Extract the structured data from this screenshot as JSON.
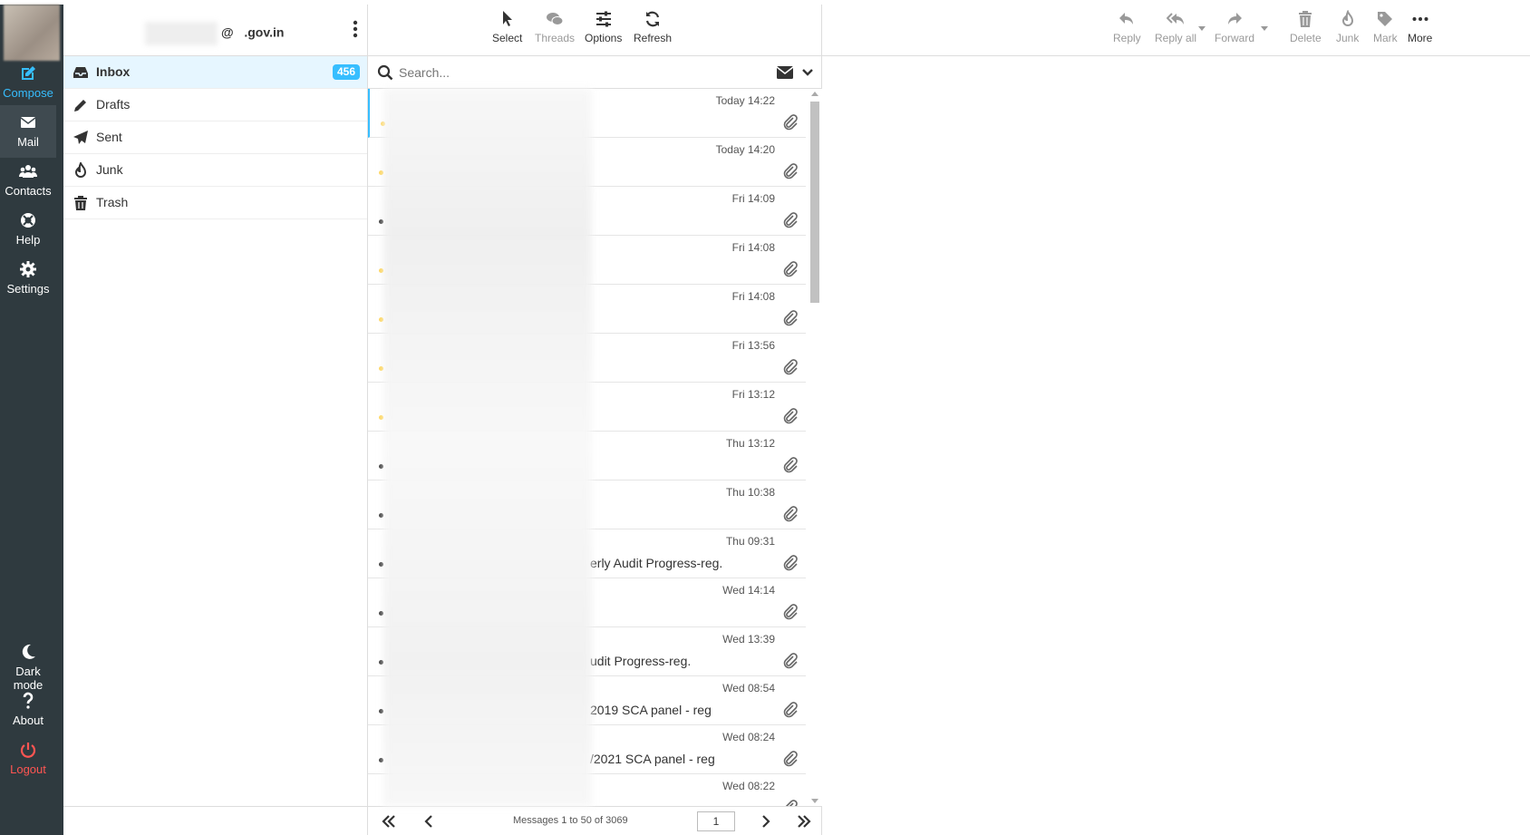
{
  "rail": {
    "compose": "Compose",
    "mail": "Mail",
    "contacts": "Contacts",
    "help": "Help",
    "settings": "Settings",
    "dark_mode": "Dark mode",
    "about": "About",
    "logout": "Logout"
  },
  "account": {
    "at": "@",
    "domain": ".gov.in"
  },
  "folders": [
    {
      "name": "Inbox",
      "icon": "inbox-icon",
      "unread": "456"
    },
    {
      "name": "Drafts",
      "icon": "pencil-icon"
    },
    {
      "name": "Sent",
      "icon": "paper-plane-icon"
    },
    {
      "name": "Junk",
      "icon": "fire-icon"
    },
    {
      "name": "Trash",
      "icon": "trash-icon"
    }
  ],
  "list_toolbar": {
    "select": "Select",
    "threads": "Threads",
    "options": "Options",
    "refresh": "Refresh"
  },
  "search": {
    "placeholder": "Search..."
  },
  "messages": [
    {
      "date": "Today 14:22",
      "subject": "",
      "unread": true
    },
    {
      "date": "Today 14:20",
      "subject": "",
      "unread": true
    },
    {
      "date": "Fri 14:09",
      "subject": "",
      "unread": false
    },
    {
      "date": "Fri 14:08",
      "subject": "",
      "unread": true
    },
    {
      "date": "Fri 14:08",
      "subject": "",
      "unread": true
    },
    {
      "date": "Fri 13:56",
      "subject": "",
      "unread": true
    },
    {
      "date": "Fri 13:12",
      "subject": "",
      "unread": true
    },
    {
      "date": "Thu 13:12",
      "subject": "",
      "unread": false
    },
    {
      "date": "Thu 10:38",
      "subject": "",
      "unread": false
    },
    {
      "date": "Thu 09:31",
      "subject": "erly Audit Progress-reg.",
      "unread": false
    },
    {
      "date": "Wed 14:14",
      "subject": "",
      "unread": false
    },
    {
      "date": "Wed 13:39",
      "subject": "udit Progress-reg.",
      "unread": false
    },
    {
      "date": "Wed 08:54",
      "subject": "2019 SCA panel - reg",
      "unread": false
    },
    {
      "date": "Wed 08:24",
      "subject": "/2021 SCA panel - reg",
      "unread": false
    },
    {
      "date": "Wed 08:22",
      "subject": "",
      "unread": false
    }
  ],
  "pager": {
    "count_text": "Messages 1 to 50 of 3069",
    "page": "1"
  },
  "preview_toolbar": {
    "reply": "Reply",
    "reply_all": "Reply all",
    "forward": "Forward",
    "delete": "Delete",
    "junk": "Junk",
    "mark": "Mark",
    "more": "More"
  },
  "colors": {
    "accent": "#37beff",
    "rail": "#2f3a3f",
    "logout": "#ff5552",
    "unread_dot": "#ffd452"
  }
}
